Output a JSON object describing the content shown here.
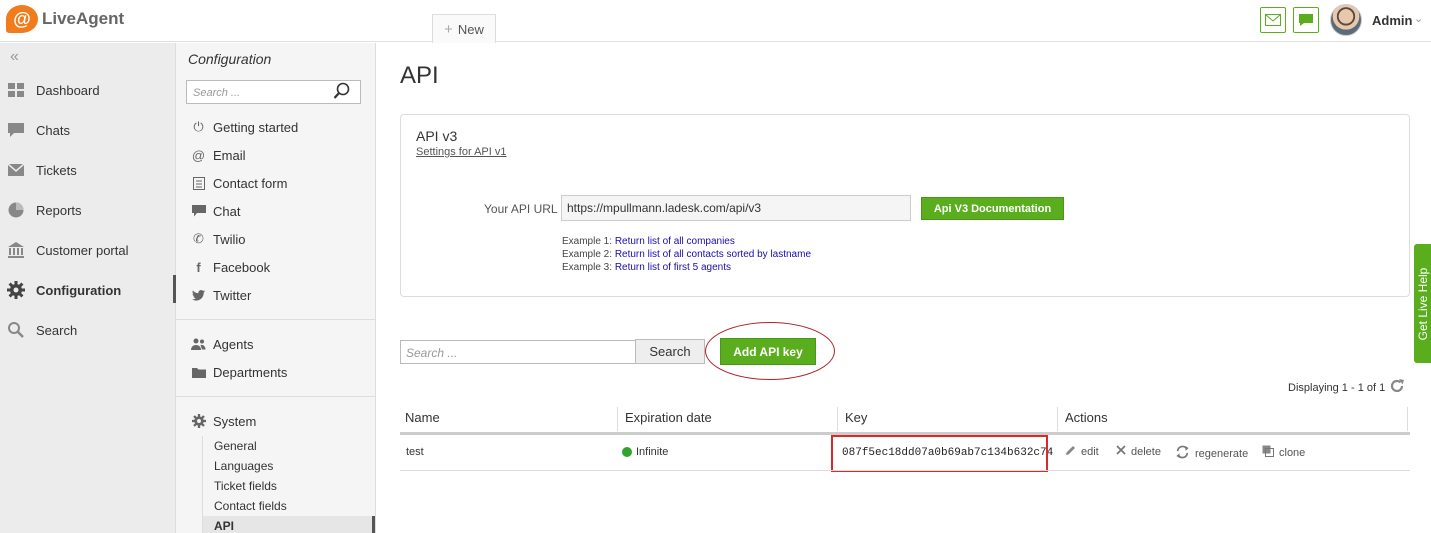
{
  "app": {
    "logo_text": "LiveAgent"
  },
  "topbar": {
    "new_tab_label": "New",
    "user_name": "Admin"
  },
  "leftnav": {
    "items": [
      {
        "label": "Dashboard"
      },
      {
        "label": "Chats"
      },
      {
        "label": "Tickets"
      },
      {
        "label": "Reports"
      },
      {
        "label": "Customer portal"
      },
      {
        "label": "Configuration",
        "active": true
      },
      {
        "label": "Search"
      }
    ]
  },
  "config": {
    "title": "Configuration",
    "search_placeholder": "Search ...",
    "group1": [
      {
        "label": "Getting started"
      },
      {
        "label": "Email"
      },
      {
        "label": "Contact form"
      },
      {
        "label": "Chat"
      },
      {
        "label": "Twilio"
      },
      {
        "label": "Facebook"
      },
      {
        "label": "Twitter"
      }
    ],
    "group2": [
      {
        "label": "Agents"
      },
      {
        "label": "Departments"
      }
    ],
    "system": {
      "label": "System",
      "subitems": [
        {
          "label": "General"
        },
        {
          "label": "Languages"
        },
        {
          "label": "Ticket fields"
        },
        {
          "label": "Contact fields"
        },
        {
          "label": "API",
          "active": true
        }
      ]
    }
  },
  "main": {
    "title": "API",
    "api_box": {
      "heading": "API v3",
      "settings_link": "Settings for API v1",
      "url_label": "Your API URL",
      "url_value": "https://mpullmann.ladesk.com/api/v3",
      "doc_button": "Api V3 Documentation",
      "examples": [
        {
          "prefix": "Example 1: ",
          "link": "Return list of all companies"
        },
        {
          "prefix": "Example 2: ",
          "link": "Return list of all contacts sorted by lastname"
        },
        {
          "prefix": "Example 3: ",
          "link": "Return list of first 5 agents"
        }
      ]
    },
    "search_placeholder": "Search ...",
    "search_button": "Search",
    "add_button": "Add API key",
    "displaying": "Displaying 1 - 1 of 1",
    "table": {
      "columns": [
        "Name",
        "Expiration date",
        "Key",
        "Actions"
      ],
      "rows": [
        {
          "name": "test",
          "expiration": "Infinite",
          "key": "087f5ec18dd07a0b69ab7c134b632c74",
          "actions": [
            "edit",
            "delete",
            "regenerate",
            "clone"
          ]
        }
      ]
    }
  },
  "side_tab": {
    "label": "Get Live Help"
  },
  "colors": {
    "accent_green": "#5aae1e",
    "highlight_red": "#d92a2a",
    "status_green": "#2fa52f"
  }
}
